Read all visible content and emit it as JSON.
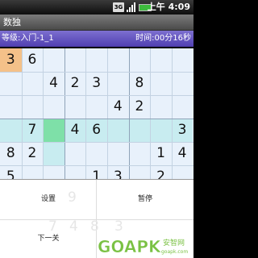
{
  "status_bar": {
    "network": "3G",
    "clock": "上午 4:09"
  },
  "title": "数独",
  "info": {
    "level": "等级:入门-1_1",
    "time": "时间:00分16秒"
  },
  "board": {
    "cells": [
      {
        "r": 0,
        "c": 0,
        "v": "3",
        "hl": "#f4c189"
      },
      {
        "r": 0,
        "c": 1,
        "v": "6"
      },
      {
        "r": 1,
        "c": 2,
        "v": "4"
      },
      {
        "r": 1,
        "c": 3,
        "v": "2"
      },
      {
        "r": 1,
        "c": 4,
        "v": "3"
      },
      {
        "r": 1,
        "c": 6,
        "v": "8"
      },
      {
        "r": 2,
        "c": 5,
        "v": "4"
      },
      {
        "r": 2,
        "c": 6,
        "v": "2"
      },
      {
        "r": 3,
        "c": 0,
        "v": "",
        "hl": "#c8ecf0"
      },
      {
        "r": 3,
        "c": 1,
        "v": "7",
        "hl": "#c8ecf0"
      },
      {
        "r": 3,
        "c": 2,
        "v": "",
        "hl": "#7ee0a8"
      },
      {
        "r": 3,
        "c": 3,
        "v": "4",
        "hl": "#c8ecf0"
      },
      {
        "r": 3,
        "c": 4,
        "v": "6",
        "hl": "#c8ecf0"
      },
      {
        "r": 3,
        "c": 5,
        "v": "",
        "hl": "#c8ecf0"
      },
      {
        "r": 3,
        "c": 6,
        "v": "",
        "hl": "#c8ecf0"
      },
      {
        "r": 3,
        "c": 7,
        "v": "",
        "hl": "#c8ecf0"
      },
      {
        "r": 3,
        "c": 8,
        "v": "3",
        "hl": "#c8ecf0"
      },
      {
        "r": 4,
        "c": 0,
        "v": "8"
      },
      {
        "r": 4,
        "c": 1,
        "v": "2"
      },
      {
        "r": 4,
        "c": 2,
        "v": "",
        "hl": "#c8ecf0"
      },
      {
        "r": 4,
        "c": 7,
        "v": "1"
      },
      {
        "r": 4,
        "c": 8,
        "v": "4"
      },
      {
        "r": 5,
        "c": 0,
        "v": "5"
      },
      {
        "r": 5,
        "c": 4,
        "v": "1"
      },
      {
        "r": 5,
        "c": 5,
        "v": "3"
      },
      {
        "r": 5,
        "c": 7,
        "v": "2"
      }
    ]
  },
  "menu": {
    "settings": "设置",
    "pause": "暂停",
    "next": "下一关"
  },
  "ghost_digits": [
    "9",
    "7",
    "4",
    "8",
    "3"
  ],
  "watermark": {
    "brand": "GOAPK",
    "site": "安智网",
    "url": "goapk.com",
    "color": "#7ac143"
  }
}
